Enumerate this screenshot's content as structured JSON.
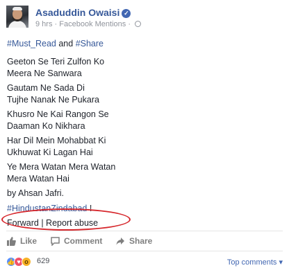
{
  "header": {
    "author": "Asaduddin Owaisi",
    "verified_icon": "verified-badge-icon",
    "time": "9 hrs",
    "separator": "·",
    "source": "Facebook Mentions",
    "privacy_separator": "·",
    "privacy_icon": "globe-icon"
  },
  "post": {
    "intro_hashtag_1": "#Must_Read",
    "intro_and": " and ",
    "intro_hashtag_2": "#Share",
    "lines": [
      "Geeton Se Teri Zulfon Ko",
      "Meera Ne Sanwara",
      "Gautam Ne Sada Di",
      "Tujhe Nanak Ne Pukara",
      "Khusro Ne Kai Rangon Se",
      "Daaman Ko Nikhara",
      "Har Dil Mein Mohabbat Ki",
      "Ukhuwat Ki Lagan Hai",
      "Ye Mera Watan Mera Watan",
      "Mera Watan Hai",
      "by Ahsan Jafri."
    ],
    "closing_hashtag": "#HindustanZindabad",
    "closing_mark": " !",
    "forward_label": "Forward",
    "pipe": " | ",
    "report_label": "Report abuse"
  },
  "actions": {
    "like": "Like",
    "comment": "Comment",
    "share": "Share"
  },
  "reactions": {
    "count": "629",
    "icons": [
      "like-reaction-icon",
      "love-reaction-icon",
      "wow-reaction-icon"
    ]
  },
  "comments_sort": {
    "label": "Top comments",
    "caret": "▾"
  },
  "colors": {
    "link": "#365899",
    "annotation": "#d6262b",
    "like_blue": "#5890ff",
    "love_red": "#f25268",
    "wow_yellow": "#f7b125"
  }
}
